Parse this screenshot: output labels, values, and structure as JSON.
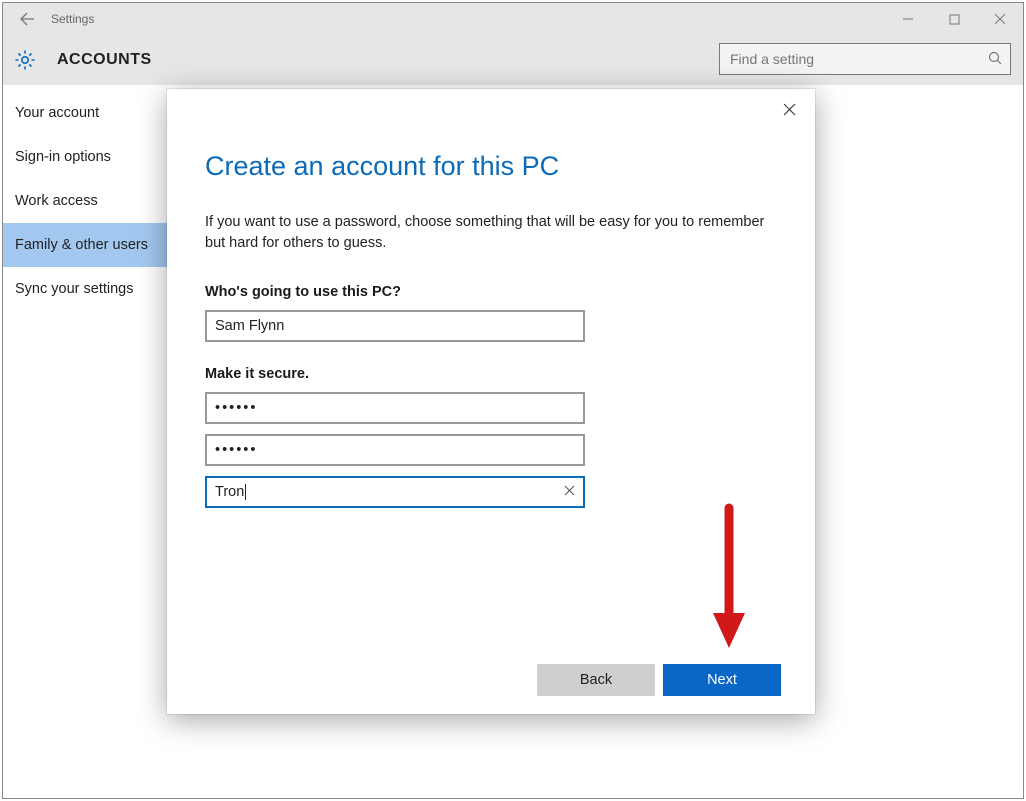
{
  "window": {
    "title": "Settings"
  },
  "header": {
    "title": "ACCOUNTS",
    "search_placeholder": "Find a setting"
  },
  "sidebar": {
    "items": [
      {
        "label": "Your account"
      },
      {
        "label": "Sign-in options"
      },
      {
        "label": "Work access"
      },
      {
        "label": "Family & other users"
      },
      {
        "label": "Sync your settings"
      }
    ],
    "selected_index": 3
  },
  "modal": {
    "title": "Create an account for this PC",
    "description": "If you want to use a password, choose something that will be easy for you to remember but hard for others to guess.",
    "who_label": "Who's going to use this PC?",
    "username_value": "Sam Flynn",
    "secure_label": "Make it secure.",
    "password_value": "••••••",
    "password_confirm_value": "••••••",
    "hint_value": "Tron",
    "back_label": "Back",
    "next_label": "Next"
  }
}
